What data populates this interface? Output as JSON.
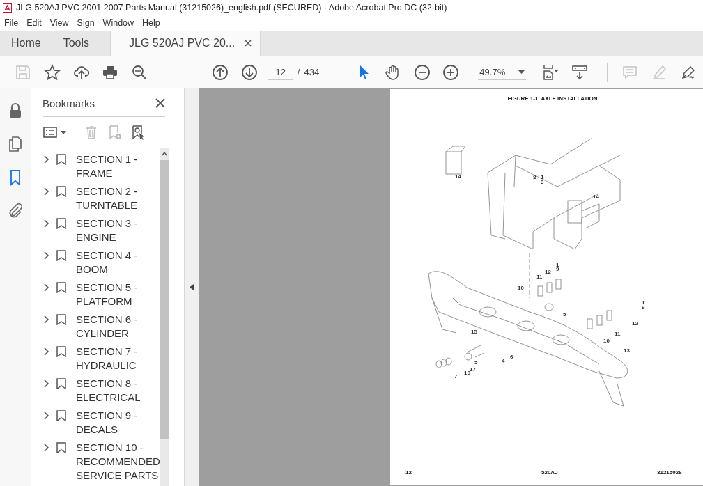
{
  "window": {
    "title": "JLG 520AJ PVC 2001 2007 Parts Manual (31215026)_english.pdf (SECURED) - Adobe Acrobat Pro DC (32-bit)"
  },
  "menu": [
    "File",
    "Edit",
    "View",
    "Sign",
    "Window",
    "Help"
  ],
  "tabs": [
    {
      "label": "Home",
      "kind": "nav",
      "selected": false
    },
    {
      "label": "Tools",
      "kind": "nav",
      "selected": false
    },
    {
      "label": "JLG 520AJ PVC 20...",
      "kind": "document",
      "selected": true
    }
  ],
  "toolbar": {
    "left": [
      {
        "kind": "save",
        "disabled": true
      },
      {
        "kind": "star",
        "disabled": false
      },
      {
        "kind": "upload",
        "disabled": false
      },
      {
        "kind": "print",
        "disabled": false
      },
      {
        "kind": "find",
        "disabled": false
      }
    ],
    "page_current": "12",
    "page_separator": "/",
    "page_total": "434",
    "tools": [
      {
        "kind": "select",
        "selected": true
      },
      {
        "kind": "hand",
        "selected": false
      }
    ],
    "zoom": "49.7%",
    "right": [
      {
        "kind": "comment",
        "disabled": true
      },
      {
        "kind": "highlight",
        "disabled": true
      },
      {
        "kind": "sign",
        "disabled": false
      }
    ]
  },
  "rail": [
    {
      "kind": "lock",
      "selected": false
    },
    {
      "kind": "pages",
      "selected": false
    },
    {
      "kind": "bookmark",
      "selected": true
    },
    {
      "kind": "attachment",
      "selected": false
    }
  ],
  "bookmarks": {
    "title": "Bookmarks",
    "items": [
      {
        "label": "SECTION 1 - FRAME",
        "expanded": false
      },
      {
        "label": "SECTION 2 - TURNTABLE",
        "expanded": false
      },
      {
        "label": "SECTION 3 - ENGINE",
        "expanded": false
      },
      {
        "label": "SECTION 4 - BOOM",
        "expanded": false
      },
      {
        "label": "SECTION 5 - PLATFORM",
        "expanded": false
      },
      {
        "label": "SECTION 6 - CYLINDER",
        "expanded": false
      },
      {
        "label": "SECTION 7 - HYDRAULIC",
        "expanded": false
      },
      {
        "label": "SECTION 8 - ELECTRICAL",
        "expanded": false
      },
      {
        "label": "SECTION 9 - DECALS",
        "expanded": false
      },
      {
        "label": "SECTION 10 - RECOMMENDED SERVICE PARTS",
        "expanded": false
      }
    ]
  },
  "page": {
    "figure_title": "FIGURE 1-1. AXLE INSTALLATION",
    "callouts": [
      "14",
      "8",
      "1",
      "3",
      "14",
      "1",
      "9",
      "12",
      "11",
      "10",
      "5",
      "1",
      "9",
      "12",
      "11",
      "10",
      "13",
      "15",
      "6",
      "4",
      "5",
      "17",
      "16",
      "7"
    ],
    "footer": [
      "12",
      "520AJ",
      "31215026"
    ]
  }
}
